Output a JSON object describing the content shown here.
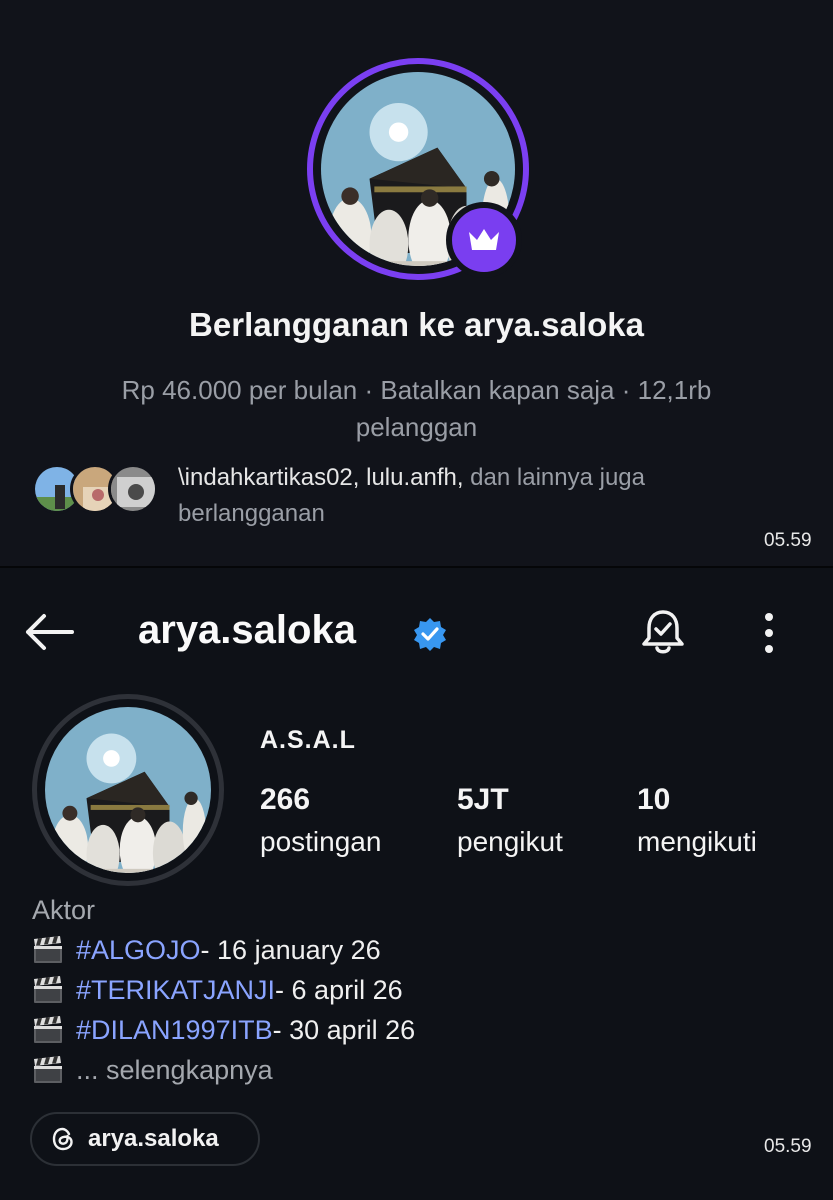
{
  "subscription": {
    "title": "Berlangganan ke arya.saloka",
    "info": "Rp 46.000 per bulan · Batalkan kapan saja · 12,1rb pelanggan",
    "subscribers_names": "\\indahkartikas02, lulu.anfh,",
    "subscribers_suffix": " dan lainnya juga berlangganan",
    "timestamp": "05.59"
  },
  "profile": {
    "username": "arya.saloka",
    "display_name": "A.S.A.L",
    "stats": [
      {
        "value": "266",
        "label": "postingan"
      },
      {
        "value": "5JT",
        "label": "pengikut"
      },
      {
        "value": "10",
        "label": "mengikuti"
      }
    ],
    "bio": {
      "category": "Aktor",
      "lines": [
        {
          "tag": "#ALGOJO",
          "date": " - 16 january 26"
        },
        {
          "tag": "#TERIKATJANJI",
          "date": " - 6 april 26"
        },
        {
          "tag": "#DILAN1997ITB",
          "date": " - 30 april 26"
        }
      ],
      "more": "... selengkapnya"
    },
    "threads_handle": "arya.saloka",
    "timestamp": "05.59"
  },
  "icons": {
    "back": "arrow-left-icon",
    "verified": "verified-badge-icon",
    "bell": "notification-bell-icon",
    "more": "more-vertical-icon",
    "crown": "crown-icon",
    "clapper": "clapper-board-icon",
    "threads": "threads-icon"
  },
  "colors": {
    "accent_purple": "#7b3ff2",
    "link_blue": "#8aa4ff",
    "verified_blue": "#3897f0"
  }
}
